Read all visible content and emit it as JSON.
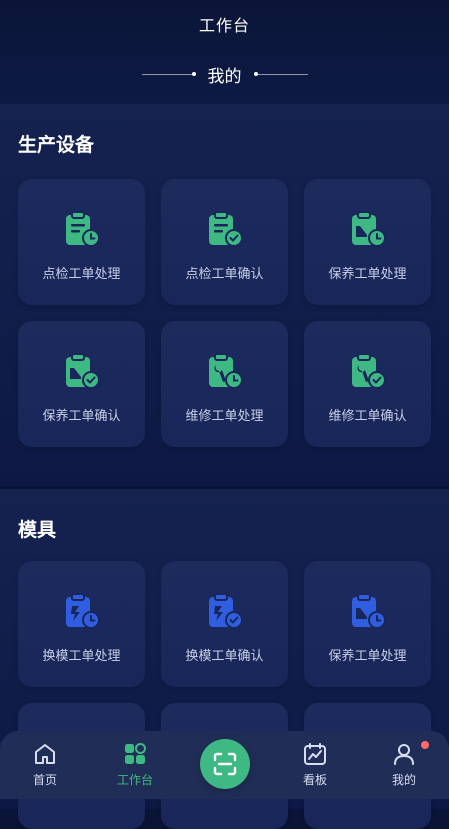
{
  "header": {
    "title": "工作台",
    "subtitle": "我的"
  },
  "sections": [
    {
      "title": "生产设备",
      "items": [
        {
          "label": "点检工单处理",
          "icon": "clipboard-clock-icon"
        },
        {
          "label": "点检工单确认",
          "icon": "clipboard-check-icon"
        },
        {
          "label": "保养工单处理",
          "icon": "oilcan-clipboard-clock-icon"
        },
        {
          "label": "保养工单确认",
          "icon": "oilcan-clipboard-check-icon"
        },
        {
          "label": "维修工单处理",
          "icon": "wrench-clipboard-clock-icon"
        },
        {
          "label": "维修工单确认",
          "icon": "wrench-clipboard-check-icon"
        }
      ]
    },
    {
      "title": "模具",
      "items": [
        {
          "label": "换模工单处理",
          "icon": "mold-change-clipboard-clock-icon"
        },
        {
          "label": "换模工单确认",
          "icon": "mold-change-clipboard-check-icon"
        },
        {
          "label": "保养工单处理",
          "icon": "oilcan-clipboard-clock-icon"
        }
      ]
    }
  ],
  "nav": {
    "items": [
      {
        "label": "首页",
        "icon": "home-icon"
      },
      {
        "label": "工作台",
        "icon": "grid-icon"
      },
      {
        "label": "",
        "icon": "scan-icon"
      },
      {
        "label": "看板",
        "icon": "calendar-chart-icon"
      },
      {
        "label": "我的",
        "icon": "user-icon"
      }
    ]
  },
  "colors": {
    "background": "#0a1437",
    "accent_green": "#3fb983",
    "accent_blue": "#2f5fe0",
    "nav_bg": "#202e57",
    "badge": "#ff6b6b"
  }
}
